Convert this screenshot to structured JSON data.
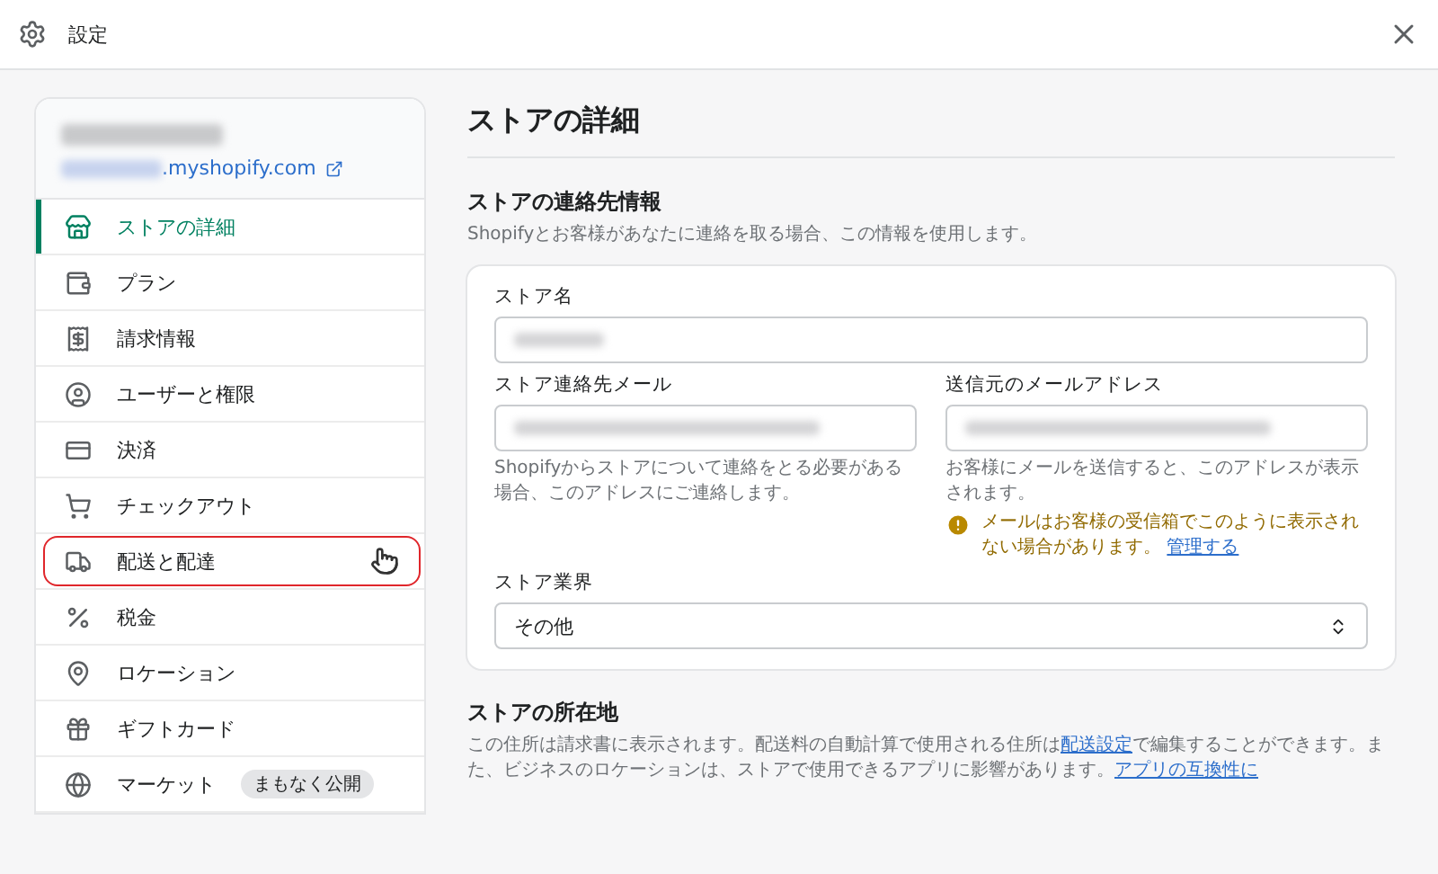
{
  "window": {
    "title": "設定"
  },
  "sidebar": {
    "store_url_suffix": ".myshopify.com",
    "items": [
      {
        "label": "ストアの詳細",
        "selected": true,
        "highlighted": false
      },
      {
        "label": "プラン",
        "selected": false,
        "highlighted": false
      },
      {
        "label": "請求情報",
        "selected": false,
        "highlighted": false
      },
      {
        "label": "ユーザーと権限",
        "selected": false,
        "highlighted": false
      },
      {
        "label": "決済",
        "selected": false,
        "highlighted": false
      },
      {
        "label": "チェックアウト",
        "selected": false,
        "highlighted": false
      },
      {
        "label": "配送と配達",
        "selected": false,
        "highlighted": true
      },
      {
        "label": "税金",
        "selected": false,
        "highlighted": false
      },
      {
        "label": "ロケーション",
        "selected": false,
        "highlighted": false
      },
      {
        "label": "ギフトカード",
        "selected": false,
        "highlighted": false
      },
      {
        "label": "マーケット",
        "selected": false,
        "highlighted": false,
        "badge": "まもなく公開"
      }
    ]
  },
  "main": {
    "title": "ストアの詳細",
    "contact": {
      "title": "ストアの連絡先情報",
      "description": "Shopifyとお客様があなたに連絡を取る場合、この情報を使用します。",
      "store_name": {
        "label": "ストア名"
      },
      "contact_email": {
        "label": "ストア連絡先メール",
        "help": "Shopifyからストアについて連絡をとる必要がある場合、このアドレスにご連絡します。"
      },
      "sender_email": {
        "label": "送信元のメールアドレス",
        "help": "お客様にメールを送信すると、このアドレスが表示されます。",
        "warning": "メールはお客様の受信箱でこのように表示されない場合があります。",
        "warning_link": "管理する"
      },
      "industry": {
        "label": "ストア業界",
        "value": "その他"
      }
    },
    "address": {
      "title": "ストアの所在地",
      "description_before": "この住所は請求書に表示されます。配送料の自動計算で使用される住所は",
      "description_link": "配送設定",
      "description_after": "で編集することができます。また、ビジネスのロケーションは、ストアで使用できるアプリに影響があります。",
      "description_link2": "アプリの互換性に"
    }
  }
}
